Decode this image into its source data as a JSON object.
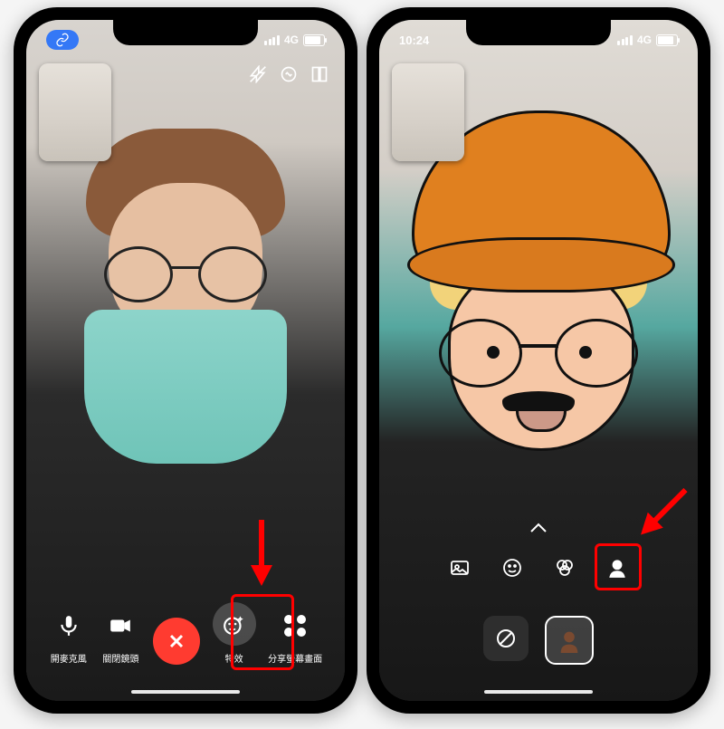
{
  "status": {
    "network": "4G",
    "time": "10:24"
  },
  "controls": {
    "mic_label": "開麥克風",
    "camera_label": "關閉鏡頭",
    "effects_label": "特效",
    "share_screen_label": "分享螢幕畫面"
  },
  "icons": {
    "link": "link-icon",
    "flash": "flash-off-icon",
    "flip": "flip-camera-icon",
    "grid": "grid-icon",
    "mic": "microphone-icon",
    "video": "video-icon",
    "close": "close-icon",
    "effects": "sparkle-face-icon",
    "apps": "app-grid-icon",
    "photo": "photo-icon",
    "smiley": "smiley-icon",
    "filters": "filters-icon",
    "memoji": "memoji-icon",
    "none": "none-icon",
    "chevron_up": "chevron-up-icon"
  }
}
